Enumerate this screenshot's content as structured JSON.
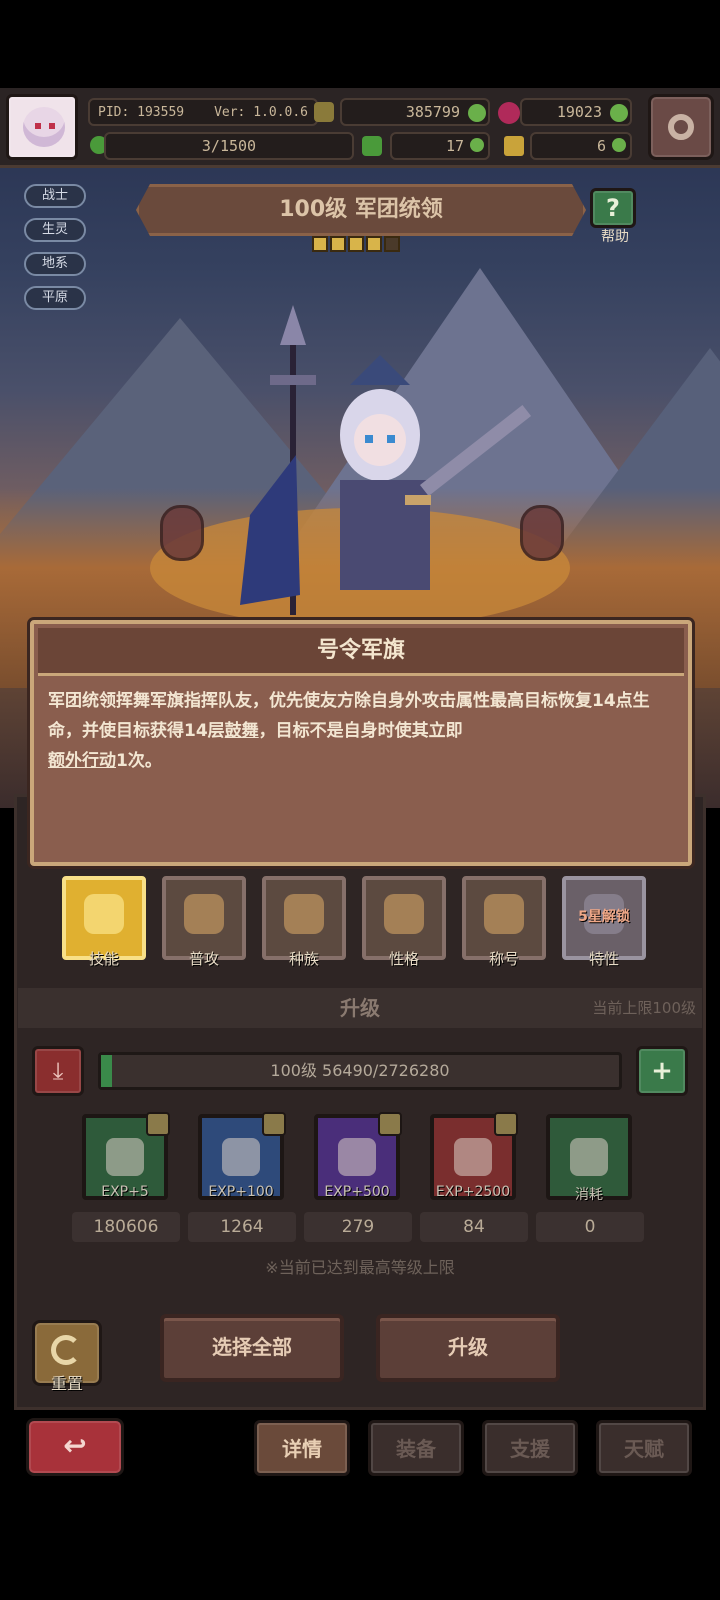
{
  "header": {
    "pid": "PID: 193559",
    "version": "Ver: 1.0.0.6",
    "exp_progress": "3/1500",
    "coins": "385799",
    "gems": "19023",
    "clover": "17",
    "boots": "6"
  },
  "tags": [
    "战士",
    "生灵",
    "地系",
    "平原"
  ],
  "hero": {
    "title": "100级  军团统领",
    "stars": 4,
    "max_stars": 5,
    "help_label": "帮助"
  },
  "dialog": {
    "title": "号令军旗",
    "text_part1": "军团统领挥舞军旗指挥队友，优先使友方除自身外攻击属性最高目标恢复14点生命，并使目标获得14层",
    "link1": "鼓舞",
    "text_part2": "，目标不是自身时使其立即",
    "link2": "额外行动",
    "text_part3": "1次。"
  },
  "categories": [
    {
      "label": "技能",
      "active": true
    },
    {
      "label": "普攻",
      "active": false
    },
    {
      "label": "种族",
      "active": false
    },
    {
      "label": "性格",
      "active": false
    },
    {
      "label": "称号",
      "active": false
    },
    {
      "label": "特性",
      "active": false,
      "lock_text": "5星解锁"
    }
  ],
  "upgrade": {
    "section_title": "升级",
    "limit_text": "当前上限100级",
    "bar_text": "100级  56490/2726280",
    "bar_fill": 0.0207,
    "max_notice": "※当前已达到最高等级上限"
  },
  "items": [
    {
      "label": "EXP+5",
      "count": "180606",
      "color": "#2e5a3a"
    },
    {
      "label": "EXP+100",
      "count": "1264",
      "color": "#2e4a7a"
    },
    {
      "label": "EXP+500",
      "count": "279",
      "color": "#4a2e7a"
    },
    {
      "label": "EXP+2500",
      "count": "84",
      "color": "#7a2e2e"
    },
    {
      "label": "消耗",
      "count": "0",
      "color": "#2f5a3a"
    }
  ],
  "buttons": {
    "reset": "重置",
    "select_all": "选择全部",
    "upgrade": "升级"
  },
  "nav": {
    "details": "详情",
    "equipment": "装备",
    "support": "支援",
    "talent": "天赋"
  }
}
